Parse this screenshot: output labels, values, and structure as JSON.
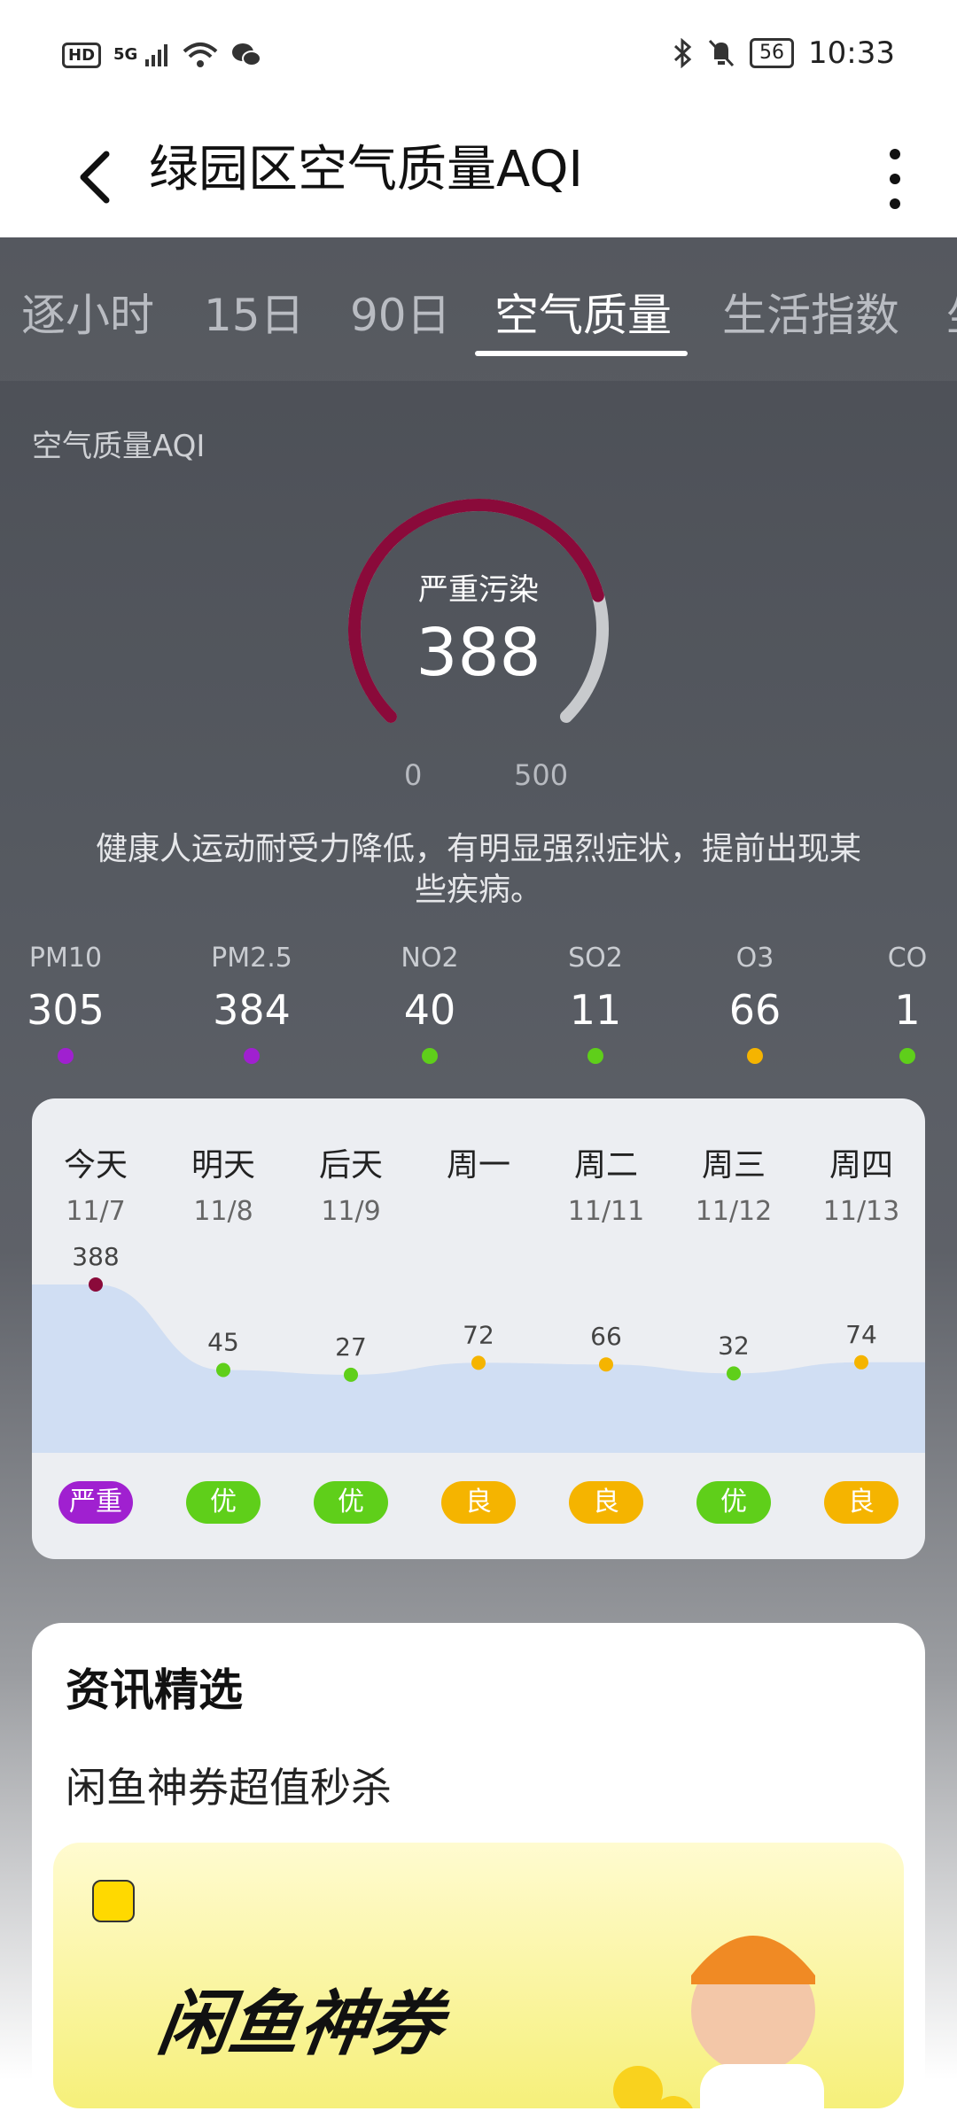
{
  "status_bar": {
    "hd": "HD",
    "signal": "5G",
    "battery": "56",
    "time": "10:33"
  },
  "header": {
    "title": "绿园区空气质量AQI"
  },
  "tabs": [
    {
      "label": "逐小时"
    },
    {
      "label": "15日"
    },
    {
      "label": "90日"
    },
    {
      "label": "空气质量"
    },
    {
      "label": "生活指数"
    },
    {
      "label": "坐"
    }
  ],
  "aqi": {
    "section_label": "空气质量AQI",
    "status": "严重污染",
    "value": "388",
    "min": "0",
    "max": "500",
    "description": "健康人运动耐受力降低，有明显强烈症状，提前出现某些疾病。",
    "gauge_color": "#8a0a3a",
    "gauge_fraction": 0.776
  },
  "pollutants": [
    {
      "name": "PM10",
      "value": "305",
      "color": "#a020d0"
    },
    {
      "name": "PM2.5",
      "value": "384",
      "color": "#a020d0"
    },
    {
      "name": "NO2",
      "value": "40",
      "color": "#5fcf1a"
    },
    {
      "name": "SO2",
      "value": "11",
      "color": "#5fcf1a"
    },
    {
      "name": "O3",
      "value": "66",
      "color": "#f5b400"
    },
    {
      "name": "CO",
      "value": "1",
      "color": "#5fcf1a"
    }
  ],
  "forecast": [
    {
      "day": "今天",
      "date": "11/7",
      "aqi": 388,
      "level": "严重",
      "color": "#a020d0",
      "dot_color": "#8a0a3a"
    },
    {
      "day": "明天",
      "date": "11/8",
      "aqi": 45,
      "level": "优",
      "color": "#5fcf1a",
      "dot_color": "#5fcf1a"
    },
    {
      "day": "后天",
      "date": "11/9",
      "aqi": 27,
      "level": "优",
      "color": "#5fcf1a",
      "dot_color": "#5fcf1a"
    },
    {
      "day": "周一",
      "date": "",
      "aqi": 72,
      "level": "良",
      "color": "#f5b400",
      "dot_color": "#f5b400"
    },
    {
      "day": "周二",
      "date": "11/11",
      "aqi": 66,
      "level": "良",
      "color": "#f5b400",
      "dot_color": "#f5b400"
    },
    {
      "day": "周三",
      "date": "11/12",
      "aqi": 32,
      "level": "优",
      "color": "#5fcf1a",
      "dot_color": "#5fcf1a"
    },
    {
      "day": "周四",
      "date": "11/13",
      "aqi": 74,
      "level": "良",
      "color": "#f5b400",
      "dot_color": "#f5b400"
    }
  ],
  "news": {
    "title": "资讯精选",
    "subtitle": "闲鱼神券超值秒杀",
    "banner_text": "闲鱼神券"
  }
}
